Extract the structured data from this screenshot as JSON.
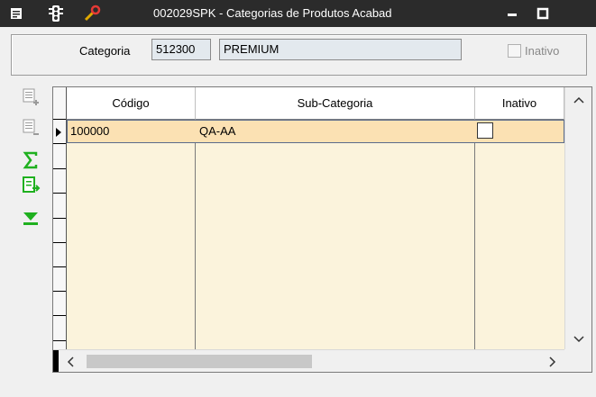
{
  "window": {
    "title": "002029SPK - Categorias de Produtos Acabad",
    "icons": [
      "list-icon",
      "traffic-light-icon",
      "wrench-icon"
    ],
    "controls": [
      "minimize-icon",
      "maximize-icon"
    ]
  },
  "header_panel": {
    "categoria_label": "Categoria",
    "categoria_code": "512300",
    "categoria_name": "PREMIUM",
    "inativo_label": "Inativo",
    "inativo_checked": false
  },
  "toolbar": {
    "items": [
      "add-row-icon",
      "remove-row-icon",
      "sum-icon",
      "export-icon",
      "last-record-icon"
    ]
  },
  "grid": {
    "columns": [
      "Código",
      "Sub-Categoria",
      "Inativo"
    ],
    "rows": [
      {
        "codigo": "100000",
        "subcategoria": "QA-AA",
        "inativo": false
      }
    ]
  },
  "colors": {
    "titlebar": "#2b2b2b",
    "grid_background": "#fbf3dc",
    "selected_row": "#fbe1b3",
    "accent_green": "#1fb01f"
  }
}
